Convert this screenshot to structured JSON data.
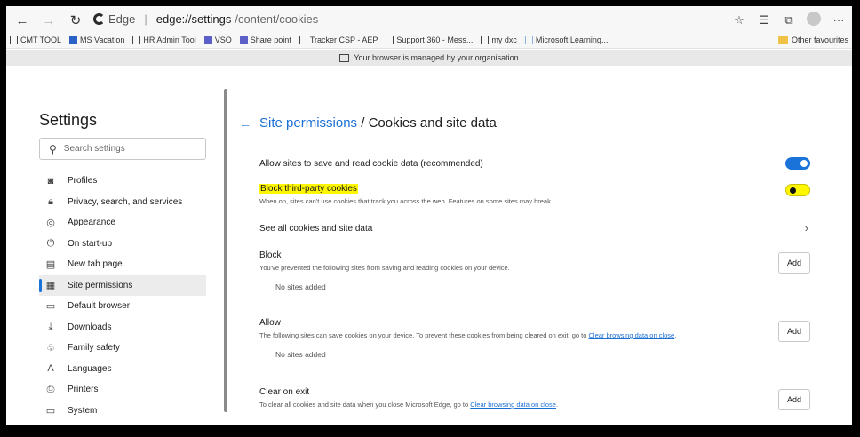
{
  "browser": {
    "nav": {
      "back": "←",
      "forward": "→",
      "refresh": "↻"
    },
    "address": {
      "brand": "Edge",
      "host": "edge://settings",
      "path": "/content/cookies"
    },
    "toolbar_icons": [
      "star-icon",
      "favorites-icon",
      "collections-icon",
      "profile-icon",
      "more-icon"
    ],
    "favorites": [
      {
        "label": "CMT TOOL",
        "icon": "page-icon"
      },
      {
        "label": "MS Vacation",
        "icon": "app-icon"
      },
      {
        "label": "HR Admin Tool",
        "icon": "page-icon"
      },
      {
        "label": "VSO",
        "icon": "vso-icon"
      },
      {
        "label": "Share point",
        "icon": "vso-icon"
      },
      {
        "label": "Tracker CSP - AEP",
        "icon": "page-icon"
      },
      {
        "label": "Support 360 - Mess...",
        "icon": "page-icon"
      },
      {
        "label": "my dxc",
        "icon": "page-icon"
      },
      {
        "label": "Microsoft Learning...",
        "icon": "learning-icon"
      }
    ],
    "other_favourites": "Other favourites",
    "managed_notice": "Your browser is managed by your organisation"
  },
  "sidebar": {
    "title": "Settings",
    "search_placeholder": "Search settings",
    "items": [
      {
        "label": "Profiles",
        "icon": "profile-icon",
        "glyph": "◙"
      },
      {
        "label": "Privacy, search, and services",
        "icon": "lock-icon",
        "glyph": "🔒︎"
      },
      {
        "label": "Appearance",
        "icon": "palette-icon",
        "glyph": "◎"
      },
      {
        "label": "On start-up",
        "icon": "power-icon",
        "glyph": "⏻"
      },
      {
        "label": "New tab page",
        "icon": "newtab-icon",
        "glyph": "▤"
      },
      {
        "label": "Site permissions",
        "icon": "site-permissions-icon",
        "glyph": "▦",
        "active": true
      },
      {
        "label": "Default browser",
        "icon": "browser-icon",
        "glyph": "▭"
      },
      {
        "label": "Downloads",
        "icon": "download-icon",
        "glyph": "⤓"
      },
      {
        "label": "Family safety",
        "icon": "family-icon",
        "glyph": "♧"
      },
      {
        "label": "Languages",
        "icon": "languages-icon",
        "glyph": "A"
      },
      {
        "label": "Printers",
        "icon": "printer-icon",
        "glyph": "⎙"
      },
      {
        "label": "System",
        "icon": "system-icon",
        "glyph": "▭"
      }
    ]
  },
  "main": {
    "breadcrumb_link": "Site permissions",
    "breadcrumb_sep": " / ",
    "title": "Cookies and site data",
    "allow_cookies": {
      "label": "Allow sites to save and read cookie data (recommended)",
      "on": true
    },
    "block_third_party": {
      "label": "Block third-party cookies",
      "desc": "When on, sites can't use cookies that track you across the web. Features on some sites may break.",
      "on": false
    },
    "see_all": {
      "label": "See all cookies and site data"
    },
    "block": {
      "title": "Block",
      "desc": "You've prevented the following sites from saving and reading cookies on your device.",
      "empty": "No sites added",
      "button": "Add"
    },
    "allow": {
      "title": "Allow",
      "desc": "The following sites can save cookies on your device. To prevent these cookies from being cleared on exit, go to ",
      "link": "Clear browsing data on close",
      "desc_end": ".",
      "empty": "No sites added",
      "button": "Add"
    },
    "clear_on_exit": {
      "title": "Clear on exit",
      "desc": "To clear all cookies and site data when you close Microsoft Edge, go to ",
      "link": "Clear browsing data on close",
      "desc_end": ".",
      "button": "Add"
    }
  },
  "colors": {
    "accent": "#1a73d9",
    "highlight": "#fff700",
    "frame": "#000000"
  }
}
